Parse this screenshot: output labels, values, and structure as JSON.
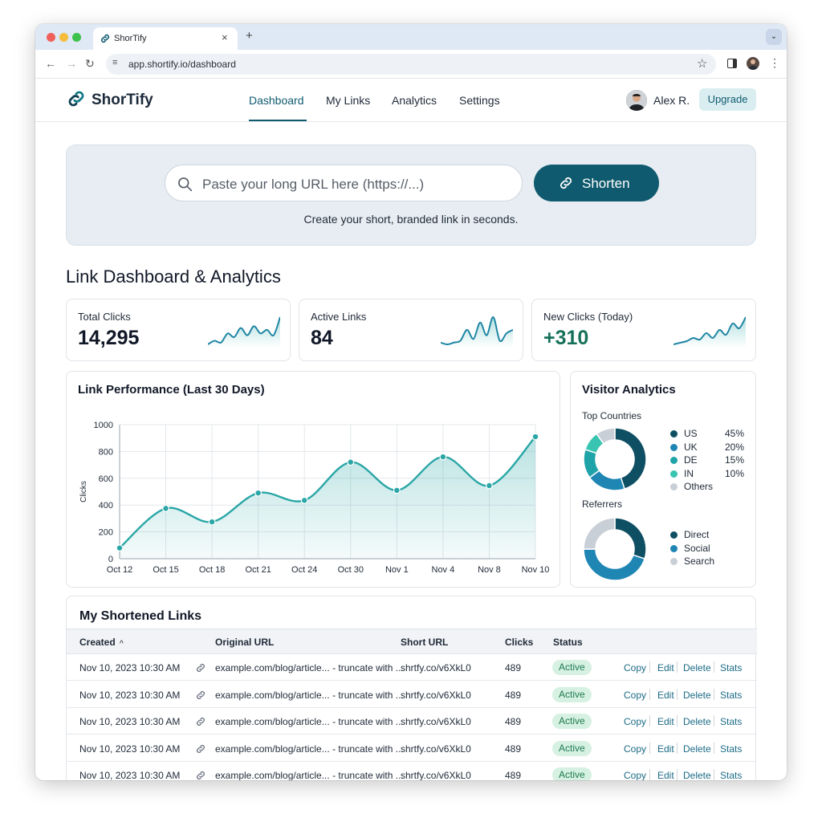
{
  "browser": {
    "tab_title": "ShorTify",
    "tab_close": "×",
    "new_tab": "+",
    "url": "app.shortify.io/dashboard"
  },
  "header": {
    "logo": "ShorTify",
    "nav": [
      "Dashboard",
      "My Links",
      "Analytics",
      "Settings"
    ],
    "active_nav": "Dashboard",
    "user_name": "Alex R.",
    "upgrade_label": "Upgrade"
  },
  "shorten": {
    "placeholder": "Paste your long URL here (https://...)",
    "button_label": "Shorten",
    "subtitle": "Create your short, branded link in seconds."
  },
  "section_title": "Link Dashboard & Analytics",
  "stats": [
    {
      "label": "Total Clicks",
      "value": "14,295",
      "spark": [
        10,
        14,
        12,
        22,
        18,
        28,
        20,
        30,
        22,
        26,
        20,
        40
      ]
    },
    {
      "label": "Active Links",
      "value": "84",
      "spark": [
        12,
        10,
        12,
        14,
        26,
        16,
        34,
        20,
        40,
        14,
        22,
        26
      ]
    },
    {
      "label": "New Clicks (Today)",
      "value": "+310",
      "spark": [
        10,
        12,
        14,
        18,
        16,
        24,
        18,
        28,
        22,
        36,
        30,
        44
      ]
    }
  ],
  "chart_data": {
    "type": "area",
    "title": "Link Performance (Last 30 Days)",
    "ylabel": "Clicks",
    "xlabel": "",
    "categories": [
      "Oct 12",
      "Oct 15",
      "Oct 18",
      "Oct 21",
      "Oct 24",
      "Oct 30",
      "Nov 1",
      "Nov 4",
      "Nov 8",
      "Nov 10"
    ],
    "values": [
      80,
      375,
      275,
      490,
      435,
      720,
      510,
      760,
      545,
      910
    ],
    "yticks": [
      0,
      200,
      400,
      600,
      800,
      1000
    ],
    "ylim": [
      0,
      1000
    ],
    "grid": true,
    "color": "#2aa6a6"
  },
  "visitors": {
    "title": "Visitor Analytics",
    "countries_title": "Top Countries",
    "countries": [
      {
        "name": "US",
        "pct": "45%",
        "value": 45,
        "color": "#0f4f63"
      },
      {
        "name": "UK",
        "pct": "20%",
        "value": 20,
        "color": "#1f86b4"
      },
      {
        "name": "DE",
        "pct": "15%",
        "value": 15,
        "color": "#1ea3a8"
      },
      {
        "name": "IN",
        "pct": "10%",
        "value": 10,
        "color": "#38c4b0"
      },
      {
        "name": "Others",
        "pct": "",
        "value": 10,
        "color": "#c9cfd6"
      }
    ],
    "referrers_title": "Referrers",
    "referrers": [
      {
        "name": "Direct",
        "value": 30,
        "color": "#0f4f63"
      },
      {
        "name": "Social",
        "value": 45,
        "color": "#1f86b4"
      },
      {
        "name": "Search",
        "value": 25,
        "color": "#c9cfd6"
      }
    ]
  },
  "links": {
    "title": "My Shortened Links",
    "columns": [
      "Created",
      "Original URL",
      "Short URL",
      "Clicks",
      "Status"
    ],
    "rows": [
      {
        "created": "Nov 10, 2023 10:30 AM",
        "original": "example.com/blog/article... - truncate with ...",
        "short": "shrtfy.co/v6XkL0",
        "clicks": "489",
        "status": "Active"
      },
      {
        "created": "Nov 10, 2023 10:30 AM",
        "original": "example.com/blog/article... - truncate with ...",
        "short": "shrtfy.co/v6XkL0",
        "clicks": "489",
        "status": "Active"
      },
      {
        "created": "Nov 10, 2023 10:30 AM",
        "original": "example.com/blog/article... - truncate with ...",
        "short": "shrtfy.co/v6XkL0",
        "clicks": "489",
        "status": "Active"
      },
      {
        "created": "Nov 10, 2023 10:30 AM",
        "original": "example.com/blog/article... - truncate with ...",
        "short": "shrtfy.co/v6XkL0",
        "clicks": "489",
        "status": "Active"
      },
      {
        "created": "Nov 10, 2023 10:30 AM",
        "original": "example.com/blog/article... - truncate with ...",
        "short": "shrtfy.co/v6XkL0",
        "clicks": "489",
        "status": "Active"
      }
    ],
    "actions": [
      "Copy",
      "Edit",
      "Delete",
      "Stats"
    ]
  }
}
